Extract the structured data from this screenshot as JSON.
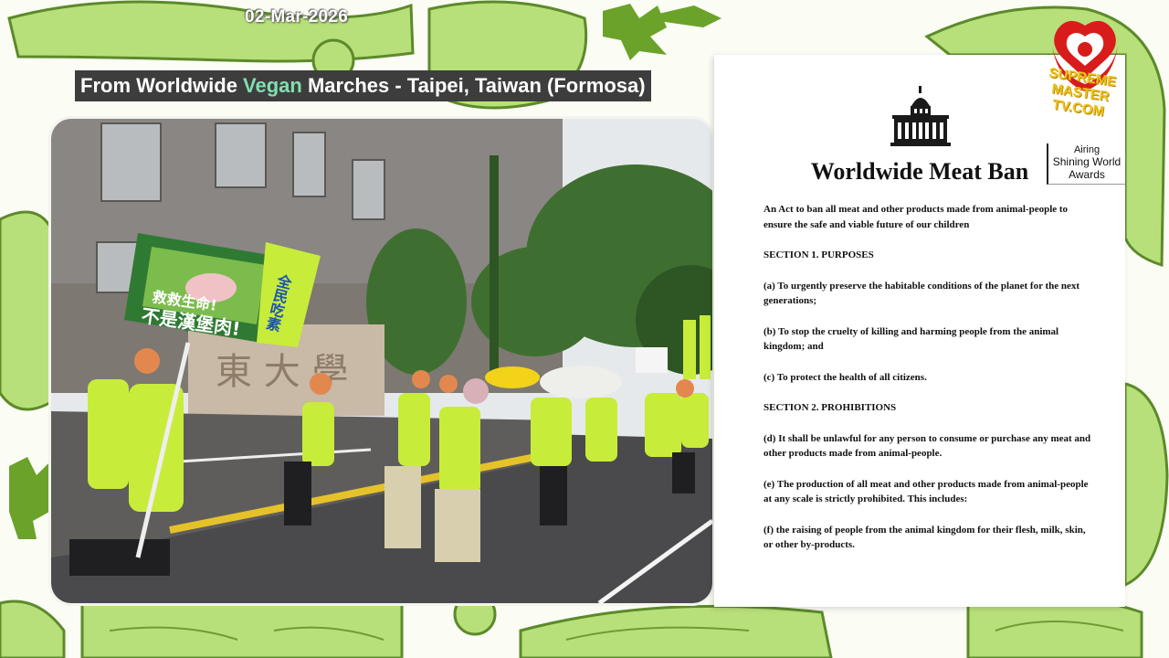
{
  "date": "02-Mar-2026",
  "headline": {
    "part1": "From Worldwide ",
    "highlight": "Vegan",
    "part2": " Marches - Taipei, Taiwan (Formosa)"
  },
  "photo": {
    "sign_line1": "救救生命!",
    "sign_line2": "不是漢堡肉!",
    "banner_text": "全民吃素"
  },
  "document": {
    "title": "Worldwide Meat Ban",
    "intro": "An Act to ban all meat and other products made from animal-people to ensure the safe and viable future of our children",
    "section1": "SECTION 1. PURPOSES",
    "item_a": "(a)   To urgently preserve the habitable conditions of the planet for the next generations;",
    "item_b": "(b)   To stop the cruelty of killing and harming people from the animal kingdom; and",
    "item_c": "(c)   To protect the health of all citizens.",
    "section2": "SECTION 2. PROHIBITIONS",
    "item_d": "(d)   It shall be unlawful for any person to consume or purchase any meat and other products made from animal-people.",
    "item_e": "(e)   The production of all meat and other products made from animal-people at any scale is strictly prohibited. This includes:",
    "item_f": "(f)     the raising of people from the animal kingdom for their flesh, milk, skin, or other by-products."
  },
  "logo": {
    "line1": "SUPREME MASTER",
    "line2": "TV.COM"
  },
  "airing": {
    "label": "Airing",
    "program": "Shining World Awards"
  },
  "colors": {
    "highlight": "#7fe0b0",
    "headline_bg": "#3d3d3d",
    "vest": "#c8ec3a",
    "logo_red": "#d81c1c",
    "logo_gold": "#f0c21b"
  }
}
